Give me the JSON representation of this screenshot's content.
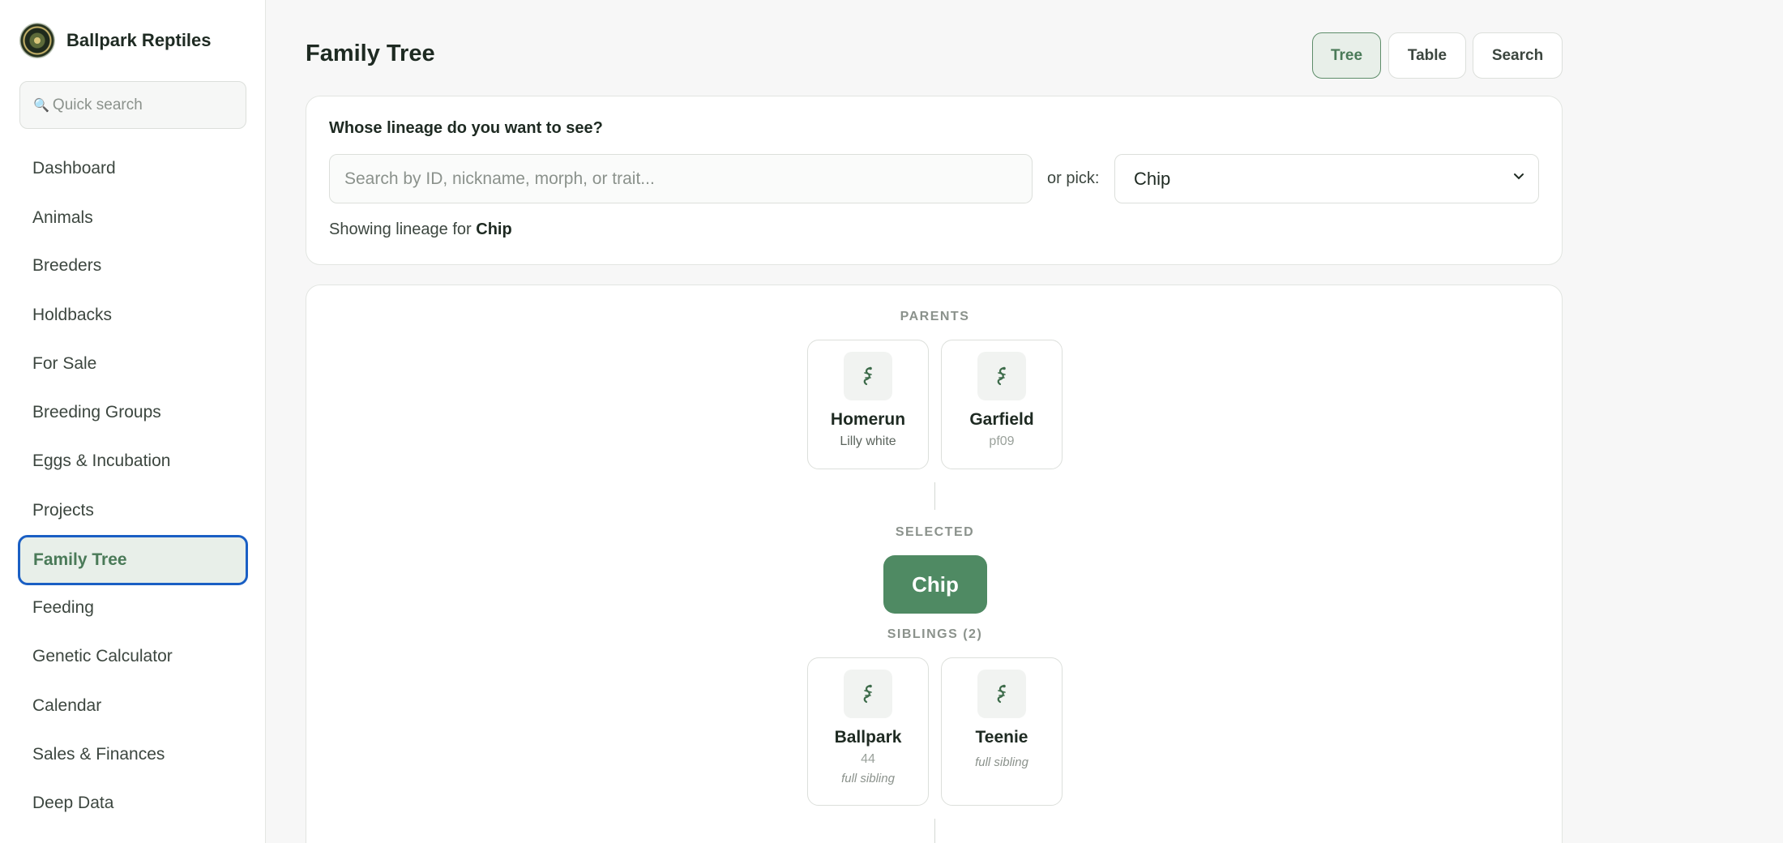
{
  "brand": {
    "name": "Ballpark Reptiles",
    "logo_icon": "brand-logo-icon"
  },
  "sidebar": {
    "search_placeholder": "Quick search",
    "search_icon": "🔍",
    "items": [
      {
        "label": "Dashboard"
      },
      {
        "label": "Animals"
      },
      {
        "label": "Breeders"
      },
      {
        "label": "Holdbacks"
      },
      {
        "label": "For Sale"
      },
      {
        "label": "Breeding Groups"
      },
      {
        "label": "Eggs & Incubation"
      },
      {
        "label": "Projects"
      },
      {
        "label": "Family Tree",
        "active": true
      },
      {
        "label": "Feeding"
      },
      {
        "label": "Genetic Calculator"
      },
      {
        "label": "Calendar"
      },
      {
        "label": "Sales & Finances"
      },
      {
        "label": "Deep Data"
      }
    ]
  },
  "header": {
    "title": "Family Tree",
    "views": [
      {
        "label": "Tree",
        "active": true
      },
      {
        "label": "Table"
      },
      {
        "label": "Search"
      }
    ]
  },
  "lineage": {
    "question": "Whose lineage do you want to see?",
    "search_placeholder": "Search by ID, nickname, morph, or trait...",
    "or_pick": "or pick:",
    "selected_option": "Chip",
    "showing_prefix": "Showing lineage for",
    "showing_name": "Chip"
  },
  "tree": {
    "parents_label": "PARENTS",
    "parents": [
      {
        "name": "Homerun",
        "sub": "Lilly white"
      },
      {
        "name": "Garfield",
        "sub": "pf09"
      }
    ],
    "selected_label": "SELECTED",
    "selected_name": "Chip",
    "siblings_label": "SIBLINGS (2)",
    "siblings": [
      {
        "name": "Ballpark",
        "sub": "44",
        "relation": "full sibling"
      },
      {
        "name": "Teenie",
        "relation": "full sibling"
      }
    ],
    "animal_icon": "gecko-icon"
  },
  "colors": {
    "accent": "#4f8a63",
    "accent_light": "#e8efe9",
    "focus_ring": "#1a5fc4",
    "background": "#f7f7f7"
  }
}
